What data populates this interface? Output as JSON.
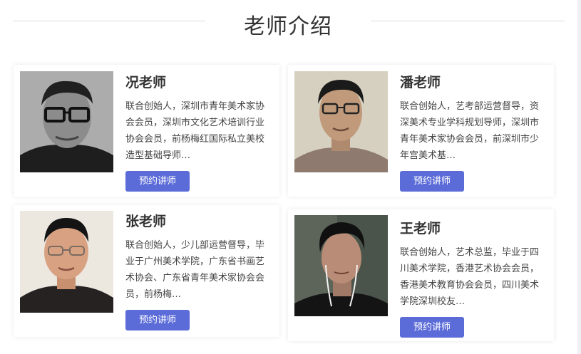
{
  "section": {
    "title": "老师介绍"
  },
  "teachers": [
    {
      "name": "况老师",
      "bio": "联合创始人，深圳市青年美术家协会会员，深圳市文化艺术培训行业协会会员，前杨梅红国际私立美校造型基础导师…",
      "button_label": "预约讲师",
      "photo_alt": "teacher-portrait-1"
    },
    {
      "name": "潘老师",
      "bio": "联合创始人，艺考部运营督导，资深美术专业学科规划导师，深圳市青年美术家协会会员，前深圳市少年宫美术基…",
      "button_label": "预约讲师",
      "photo_alt": "teacher-portrait-2"
    },
    {
      "name": "张老师",
      "bio": "联合创始人，少儿部运营督导，毕业于广州美术学院，广东省书画艺术协会、广东省青年美术家协会会员，前杨梅…",
      "button_label": "预约讲师",
      "photo_alt": "teacher-portrait-3"
    },
    {
      "name": "王老师",
      "bio": "联合创始人，艺术总监，毕业于四川美术学院，香港艺术协会会员，香港美术教育协会会员，四川美术学院深圳校友…",
      "button_label": "预约讲师",
      "photo_alt": "teacher-portrait-4"
    }
  ],
  "colors": {
    "accent": "#5b6cd8",
    "text": "#333333"
  }
}
